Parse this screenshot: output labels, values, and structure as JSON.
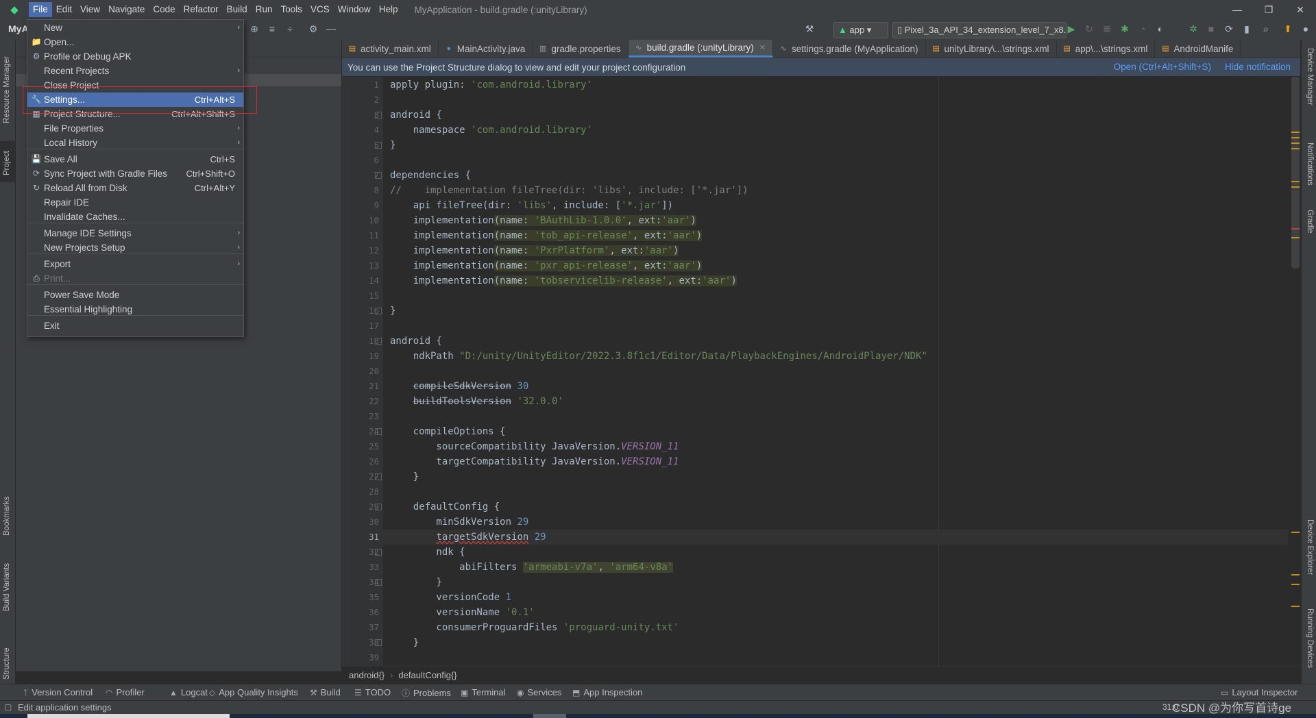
{
  "window": {
    "title": "MyApplication - build.gradle (:unityLibrary)",
    "controls": [
      "—",
      "❐",
      "✕"
    ]
  },
  "menubar": [
    "File",
    "Edit",
    "View",
    "Navigate",
    "Code",
    "Refactor",
    "Build",
    "Run",
    "Tools",
    "VCS",
    "Window",
    "Help"
  ],
  "toolbar": {
    "project": "MyA",
    "run_config": "app",
    "device": "Pixel_3a_API_34_extension_level_7_x8..."
  },
  "tabs": [
    {
      "label": "activity_main.xml",
      "icon": "xml-icon",
      "color": "#e8a33d"
    },
    {
      "label": "MainActivity.java",
      "icon": "class-icon",
      "color": "#4a8fc7"
    },
    {
      "label": "gradle.properties",
      "icon": "properties-icon",
      "color": "#9c9c9c"
    },
    {
      "label": "build.gradle (:unityLibrary)",
      "icon": "gradle-icon",
      "color": "#9c9c9c",
      "active": true
    },
    {
      "label": "settings.gradle (MyApplication)",
      "icon": "gradle-icon",
      "color": "#9c9c9c"
    },
    {
      "label": "unityLibrary\\...\\strings.xml",
      "icon": "xml-icon",
      "color": "#e8a33d"
    },
    {
      "label": "app\\...\\strings.xml",
      "icon": "xml-icon",
      "color": "#e8a33d"
    },
    {
      "label": "AndroidManife",
      "icon": "xml-icon",
      "color": "#e8a33d"
    }
  ],
  "notification": {
    "message": "You can use the Project Structure dialog to view and edit your project configuration",
    "open_link": "Open (Ctrl+Alt+Shift+S)",
    "hide_link": "Hide notification"
  },
  "editor": {
    "line_numbers": [
      "1",
      "2",
      "3",
      "4",
      "5",
      "6",
      "7",
      "8",
      "9",
      "10",
      "11",
      "12",
      "13",
      "14",
      "15",
      "16",
      "17",
      "18",
      "19",
      "20",
      "21",
      "22",
      "23",
      "24",
      "25",
      "26",
      "27",
      "28",
      "29",
      "30",
      "31",
      "32",
      "33",
      "34",
      "35",
      "36",
      "37",
      "38",
      "39"
    ],
    "breadcrumb": [
      "android{}",
      "defaultConfig{}"
    ]
  },
  "file_menu": {
    "items": [
      {
        "label": "New",
        "submenu": true
      },
      {
        "label": "Open...",
        "icon": "folder-icon"
      },
      {
        "label": "Profile or Debug APK",
        "icon": "profile-apk-icon"
      },
      {
        "label": "Recent Projects",
        "submenu": true
      },
      {
        "label": "Close Project"
      },
      {
        "label": "Settings...",
        "shortcut": "Ctrl+Alt+S",
        "icon": "wrench-icon",
        "selected": true
      },
      {
        "label": "Project Structure...",
        "shortcut": "Ctrl+Alt+Shift+S",
        "icon": "project-structure-icon"
      },
      {
        "label": "File Properties",
        "submenu": true
      },
      {
        "label": "Local History",
        "submenu": true
      },
      {
        "label": "Save All",
        "shortcut": "Ctrl+S",
        "icon": "save-icon"
      },
      {
        "label": "Sync Project with Gradle Files",
        "shortcut": "Ctrl+Shift+O",
        "icon": "gradle-sync-icon"
      },
      {
        "label": "Reload All from Disk",
        "shortcut": "Ctrl+Alt+Y",
        "icon": "reload-icon"
      },
      {
        "label": "Repair IDE"
      },
      {
        "label": "Invalidate Caches..."
      },
      {
        "label": "Manage IDE Settings",
        "submenu": true
      },
      {
        "label": "New Projects Setup",
        "submenu": true
      },
      {
        "label": "Export",
        "submenu": true
      },
      {
        "label": "Print...",
        "icon": "print-icon",
        "disabled": true
      },
      {
        "label": "Power Save Mode"
      },
      {
        "label": "Essential Highlighting"
      },
      {
        "label": "Exit"
      }
    ]
  },
  "left_stripe": [
    "Resource Manager",
    "Project",
    "Bookmarks",
    "Build Variants",
    "Structure"
  ],
  "right_stripe": [
    "Device Manager",
    "Notifications",
    "Gradle",
    "Device Explorer",
    "Running Devices"
  ],
  "bottom_tools": [
    "Version Control",
    "Profiler",
    "Logcat",
    "App Quality Insights",
    "Build",
    "TODO",
    "Problems",
    "Terminal",
    "Services",
    "App Inspection",
    "Layout Inspector"
  ],
  "status": {
    "message": "Edit application settings",
    "position": "31:0",
    "watermark": "CSDN @为你写首诗ge"
  },
  "colors": {
    "accent": "#4b6eaf",
    "highlight_box": "#e0262a",
    "link": "#589df6"
  }
}
